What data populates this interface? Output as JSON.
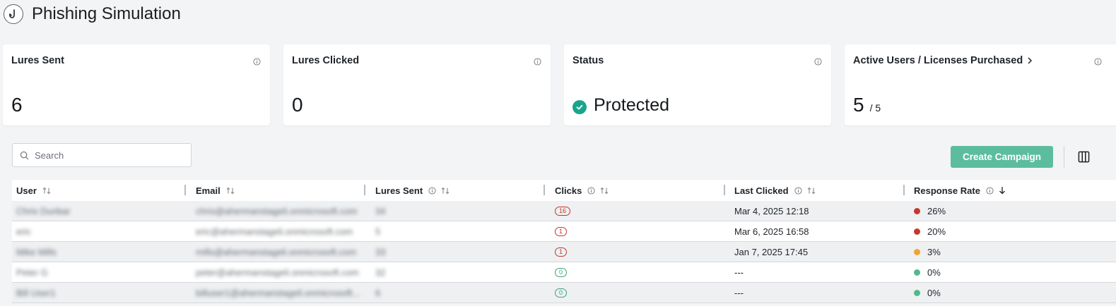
{
  "header": {
    "title": "Phishing Simulation",
    "icon": "fishing-hook-icon"
  },
  "cards": [
    {
      "title": "Lures Sent",
      "value": "6"
    },
    {
      "title": "Lures Clicked",
      "value": "0"
    },
    {
      "title": "Status",
      "value": "Protected",
      "status_color": "#1aa58a"
    },
    {
      "title": "Active Users / Licenses Purchased",
      "value": "5",
      "sub": "/ 5"
    }
  ],
  "search": {
    "placeholder": "Search"
  },
  "toolbar": {
    "create_label": "Create Campaign",
    "accent": "#5cbd9e"
  },
  "table": {
    "columns": [
      {
        "label": "User"
      },
      {
        "label": "Email"
      },
      {
        "label": "Lures Sent"
      },
      {
        "label": "Clicks"
      },
      {
        "label": "Last Clicked"
      },
      {
        "label": "Response Rate"
      }
    ],
    "rows": [
      {
        "user": "Chris Dunbar",
        "email": "chris@ahermanstageli.onmicrosoft.com",
        "lures": "34",
        "clicks": "16",
        "clicks_status": "red",
        "last_clicked": "Mar 4, 2025 12:18",
        "rate": "26%",
        "rate_color": "#c8372d"
      },
      {
        "user": "eric",
        "email": "eric@ahermanstageli.onmicrosoft.com",
        "lures": "5",
        "clicks": "1",
        "clicks_status": "red",
        "last_clicked": "Mar 6, 2025 16:58",
        "rate": "20%",
        "rate_color": "#c8372d"
      },
      {
        "user": "Mike Mills",
        "email": "mills@ahermanstageli.onmicrosoft.com",
        "lures": "33",
        "clicks": "1",
        "clicks_status": "red",
        "last_clicked": "Jan 7, 2025 17:45",
        "rate": "3%",
        "rate_color": "#efa431"
      },
      {
        "user": "Peter G",
        "email": "peter@ahermanstageli.onmicrosoft.com",
        "lures": "32",
        "clicks": "0",
        "clicks_status": "green",
        "last_clicked": "---",
        "rate": "0%",
        "rate_color": "#53b98c"
      },
      {
        "user": "Bill User1",
        "email": "billuser1@ahermanstageli.onmicrosoft...",
        "lures": "6",
        "clicks": "0",
        "clicks_status": "green",
        "last_clicked": "---",
        "rate": "0%",
        "rate_color": "#53b98c"
      }
    ]
  }
}
